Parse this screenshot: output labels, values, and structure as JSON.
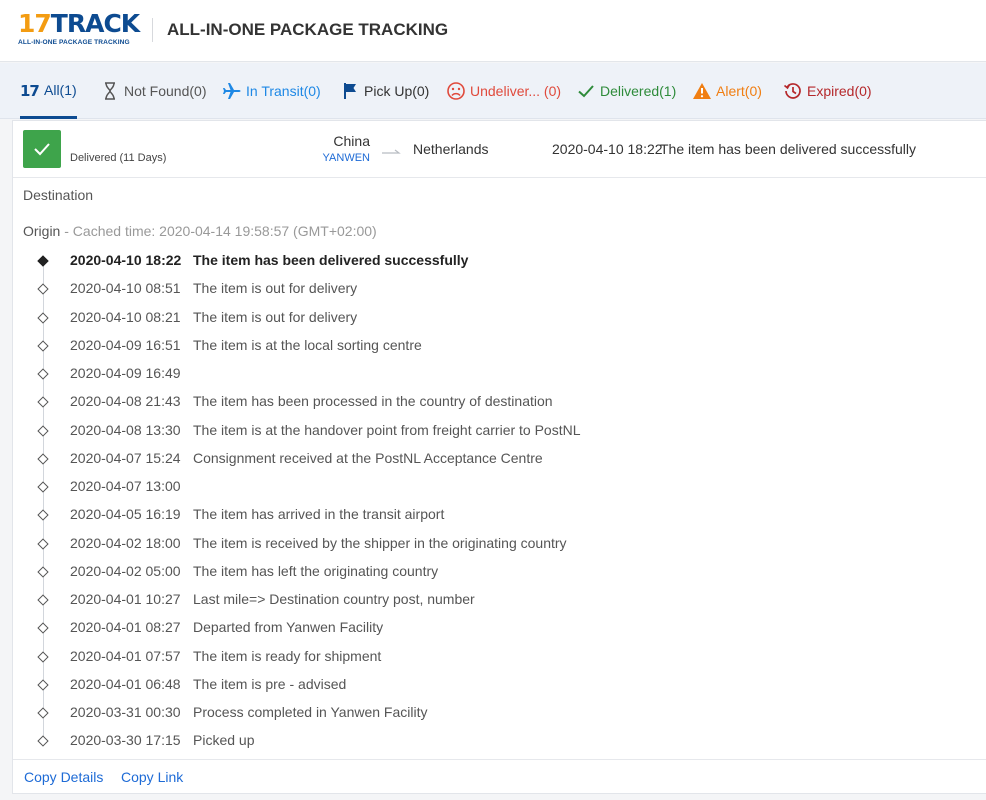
{
  "header": {
    "logo_main_num": "17",
    "logo_main_word": "TRACK",
    "logo_sub": "ALL-IN-ONE PACKAGE TRACKING",
    "title": "ALL-IN-ONE PACKAGE TRACKING"
  },
  "tabs": [
    {
      "label": "All(1)",
      "icon": "17track-icon",
      "color": "#0d4b91",
      "active": true
    },
    {
      "label": "Not Found(0)",
      "icon": "hourglass-icon",
      "color": "#555555"
    },
    {
      "label": "In Transit(0)",
      "icon": "airplane-icon",
      "color": "#1e88e5"
    },
    {
      "label": "Pick Up(0)",
      "icon": "flag-icon",
      "color": "#0d4b91"
    },
    {
      "label": "Undeliver... (0)",
      "icon": "sad-face-icon",
      "color": "#e04a3c"
    },
    {
      "label": "Delivered(1)",
      "icon": "check-icon",
      "color": "#2e8b3a"
    },
    {
      "label": "Alert(0)",
      "icon": "warning-icon",
      "color": "#f07e12"
    },
    {
      "label": "Expired(0)",
      "icon": "history-icon",
      "color": "#b5282b"
    }
  ],
  "summary": {
    "status": "Delivered (11 Days)",
    "status_color": "#3ea44b",
    "origin_country": "China",
    "origin_carrier": "YANWEN",
    "destination_country": "Netherlands",
    "latest_time": "2020-04-10 18:22",
    "latest_desc": "The item has been delivered successfully"
  },
  "destination_label": "Destination",
  "origin": {
    "label": "Origin",
    "cached": " - Cached time: 2020-04-14 19:58:57 (GMT+02:00)"
  },
  "events": [
    {
      "time": "2020-04-10 18:22",
      "desc": "The item has been delivered successfully"
    },
    {
      "time": "2020-04-10 08:51",
      "desc": "The item is out for delivery"
    },
    {
      "time": "2020-04-10 08:21",
      "desc": "The item is out for delivery"
    },
    {
      "time": "2020-04-09 16:51",
      "desc": "The item is at the local sorting centre"
    },
    {
      "time": "2020-04-09 16:49",
      "desc": ""
    },
    {
      "time": "2020-04-08 21:43",
      "desc": "The item has been processed in the country of destination"
    },
    {
      "time": "2020-04-08 13:30",
      "desc": "The item is at the handover point from freight carrier to PostNL"
    },
    {
      "time": "2020-04-07 15:24",
      "desc": "Consignment received at the PostNL Acceptance Centre"
    },
    {
      "time": "2020-04-07 13:00",
      "desc": ""
    },
    {
      "time": "2020-04-05 16:19",
      "desc": "The item has arrived in the transit airport"
    },
    {
      "time": "2020-04-02 18:00",
      "desc": "The item is received by the shipper in the originating country"
    },
    {
      "time": "2020-04-02 05:00",
      "desc": "The item has left the originating country"
    },
    {
      "time": "2020-04-01 10:27",
      "desc": "Last mile=> Destination country post, number"
    },
    {
      "time": "2020-04-01 08:27",
      "desc": "Departed from Yanwen Facility"
    },
    {
      "time": "2020-04-01 07:57",
      "desc": "The item is ready for shipment"
    },
    {
      "time": "2020-04-01 06:48",
      "desc": "The item is pre - advised"
    },
    {
      "time": "2020-03-31 00:30",
      "desc": "Process completed in Yanwen Facility"
    },
    {
      "time": "2020-03-30 17:15",
      "desc": "Picked up"
    }
  ],
  "footer": {
    "copy_details": "Copy Details",
    "copy_link": "Copy Link"
  }
}
